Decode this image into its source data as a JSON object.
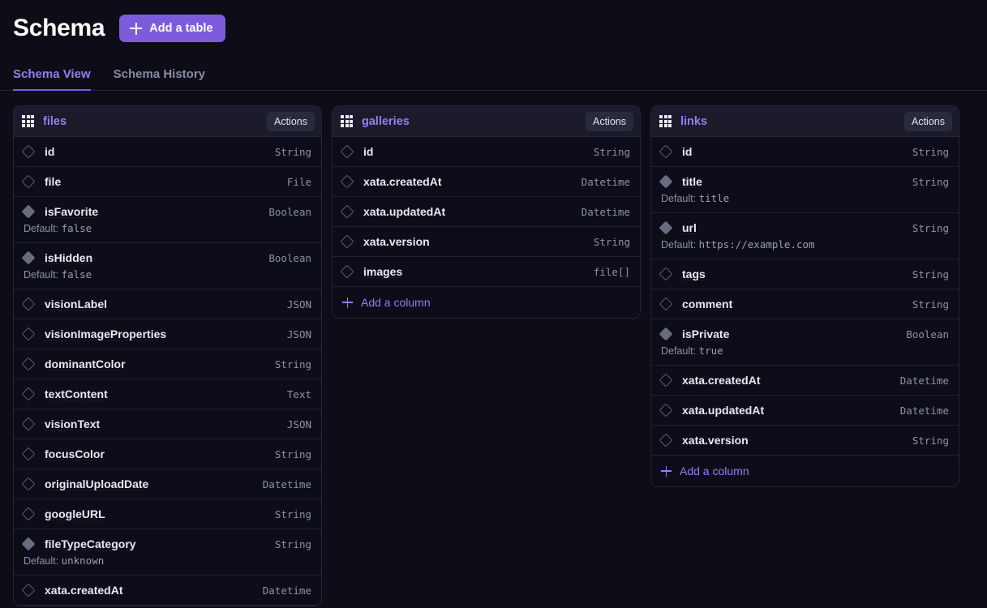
{
  "header": {
    "title": "Schema",
    "add_table_label": "Add a table"
  },
  "tabs": [
    {
      "label": "Schema View",
      "active": true
    },
    {
      "label": "Schema History",
      "active": false
    }
  ],
  "labels": {
    "actions": "Actions",
    "add_column": "Add a column",
    "default_prefix": "Default:"
  },
  "colors": {
    "accent": "#7c5cdb",
    "accent_text": "#9a7cf0",
    "page_bg": "#0d0d17",
    "card_bg": "#0d0d1a",
    "card_header_bg": "#1b1b2c",
    "border": "#24243a",
    "type_text": "#8f8fa8"
  },
  "tables": [
    {
      "name": "files",
      "actions_label": "Actions",
      "show_add_column": false,
      "truncated": true,
      "columns": [
        {
          "name": "id",
          "type": "String",
          "icon": "diamond-outline-icon",
          "link": false,
          "default": null
        },
        {
          "name": "file",
          "type": "File",
          "icon": "diamond-outline-icon",
          "link": true,
          "default": null
        },
        {
          "name": "isFavorite",
          "type": "Boolean",
          "icon": "diamond-filled-icon",
          "link": true,
          "default": "false"
        },
        {
          "name": "isHidden",
          "type": "Boolean",
          "icon": "diamond-filled-icon",
          "link": true,
          "default": "false"
        },
        {
          "name": "visionLabel",
          "type": "JSON",
          "icon": "diamond-outline-icon",
          "link": true,
          "default": null
        },
        {
          "name": "visionImageProperties",
          "type": "JSON",
          "icon": "diamond-outline-icon",
          "link": true,
          "default": null
        },
        {
          "name": "dominantColor",
          "type": "String",
          "icon": "diamond-outline-icon",
          "link": true,
          "default": null
        },
        {
          "name": "textContent",
          "type": "Text",
          "icon": "diamond-outline-icon",
          "link": true,
          "default": null
        },
        {
          "name": "visionText",
          "type": "JSON",
          "icon": "diamond-outline-icon",
          "link": true,
          "default": null
        },
        {
          "name": "focusColor",
          "type": "String",
          "icon": "diamond-outline-icon",
          "link": true,
          "default": null
        },
        {
          "name": "originalUploadDate",
          "type": "Datetime",
          "icon": "diamond-outline-icon",
          "link": true,
          "default": null
        },
        {
          "name": "googleURL",
          "type": "String",
          "icon": "diamond-outline-icon",
          "link": true,
          "default": null
        },
        {
          "name": "fileTypeCategory",
          "type": "String",
          "icon": "diamond-filled-icon",
          "link": true,
          "default": "unknown"
        },
        {
          "name": "xata.createdAt",
          "type": "Datetime",
          "icon": "diamond-outline-icon",
          "link": false,
          "default": null
        }
      ]
    },
    {
      "name": "galleries",
      "actions_label": "Actions",
      "show_add_column": true,
      "truncated": false,
      "columns": [
        {
          "name": "id",
          "type": "String",
          "icon": "diamond-outline-icon",
          "link": false,
          "default": null
        },
        {
          "name": "xata.createdAt",
          "type": "Datetime",
          "icon": "diamond-outline-icon",
          "link": false,
          "default": null
        },
        {
          "name": "xata.updatedAt",
          "type": "Datetime",
          "icon": "diamond-outline-icon",
          "link": false,
          "default": null
        },
        {
          "name": "xata.version",
          "type": "String",
          "icon": "diamond-outline-icon",
          "link": false,
          "default": null
        },
        {
          "name": "images",
          "type": "file[]",
          "icon": "diamond-outline-icon",
          "link": true,
          "default": null
        }
      ]
    },
    {
      "name": "links",
      "actions_label": "Actions",
      "show_add_column": true,
      "truncated": false,
      "columns": [
        {
          "name": "id",
          "type": "String",
          "icon": "diamond-outline-icon",
          "link": false,
          "default": null
        },
        {
          "name": "title",
          "type": "String",
          "icon": "diamond-filled-icon",
          "link": true,
          "default": "title"
        },
        {
          "name": "url",
          "type": "String",
          "icon": "diamond-filled-icon",
          "link": true,
          "default": "https://example.com"
        },
        {
          "name": "tags",
          "type": "String",
          "icon": "diamond-outline-icon",
          "link": true,
          "default": null
        },
        {
          "name": "comment",
          "type": "String",
          "icon": "diamond-outline-icon",
          "link": true,
          "default": null
        },
        {
          "name": "isPrivate",
          "type": "Boolean",
          "icon": "diamond-filled-icon",
          "link": true,
          "default": "true"
        },
        {
          "name": "xata.createdAt",
          "type": "Datetime",
          "icon": "diamond-outline-icon",
          "link": false,
          "default": null
        },
        {
          "name": "xata.updatedAt",
          "type": "Datetime",
          "icon": "diamond-outline-icon",
          "link": false,
          "default": null
        },
        {
          "name": "xata.version",
          "type": "String",
          "icon": "diamond-outline-icon",
          "link": false,
          "default": null
        }
      ]
    }
  ]
}
